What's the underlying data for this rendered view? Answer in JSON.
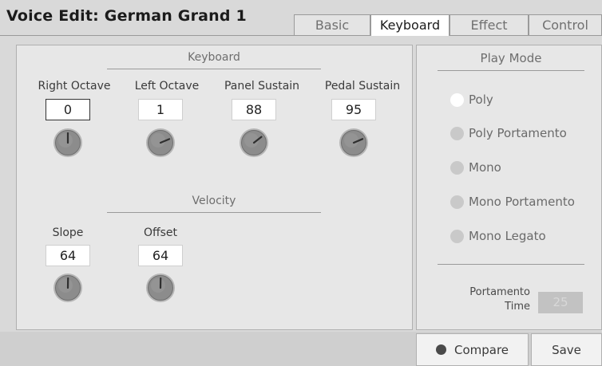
{
  "header": {
    "title": "Voice Edit: German Grand 1",
    "tabs": [
      {
        "label": "Basic",
        "active": false
      },
      {
        "label": "Keyboard",
        "active": true
      },
      {
        "label": "Effect",
        "active": false
      },
      {
        "label": "Control",
        "active": false
      }
    ]
  },
  "keyboard": {
    "section_title": "Keyboard",
    "params": [
      {
        "label": "Right Octave",
        "value": "0"
      },
      {
        "label": "Left Octave",
        "value": "1"
      },
      {
        "label": "Panel Sustain",
        "value": "88"
      },
      {
        "label": "Pedal Sustain",
        "value": "95"
      }
    ]
  },
  "velocity": {
    "section_title": "Velocity",
    "params": [
      {
        "label": "Slope",
        "value": "64"
      },
      {
        "label": "Offset",
        "value": "64"
      }
    ]
  },
  "play_mode": {
    "title": "Play Mode",
    "options": [
      "Poly",
      "Poly Portamento",
      "Mono",
      "Mono Portamento",
      "Mono Legato"
    ],
    "selected": "Poly",
    "portamento_time_label_1": "Portamento",
    "portamento_time_label_2": "Time",
    "portamento_time_value": "25"
  },
  "footer": {
    "compare_label": "Compare",
    "save_label": "Save"
  },
  "colors": {
    "background": "#d9d9d9",
    "panel": "#e7e7e7",
    "radio_selected": "#ffffff",
    "radio_unselected": "#c9c9c9",
    "knob_body": "#8c8c8c",
    "compare_led": "#4a4a4a"
  }
}
